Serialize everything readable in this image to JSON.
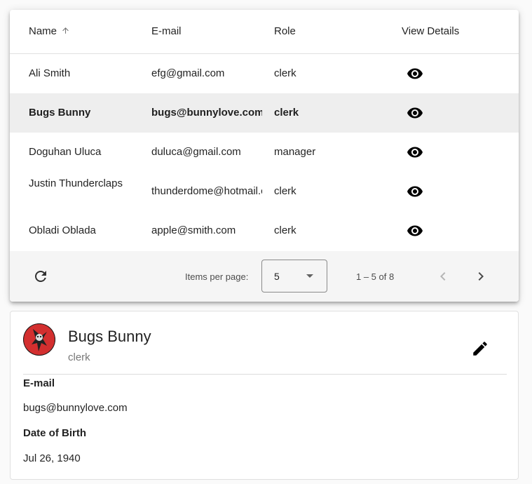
{
  "table": {
    "headers": {
      "name": "Name",
      "email": "E-mail",
      "role": "Role",
      "view": "View Details"
    },
    "sort": {
      "column": "name",
      "direction": "ascending",
      "icon": "arrow-up-icon"
    },
    "rows": [
      {
        "name": "Ali Smith",
        "email": "efg@gmail.com",
        "role": "clerk",
        "selected": false
      },
      {
        "name": "Bugs Bunny",
        "email": "bugs@bunnylove.com",
        "role": "clerk",
        "selected": true
      },
      {
        "name": "Doguhan Uluca",
        "email": "duluca@gmail.com",
        "role": "manager",
        "selected": false
      },
      {
        "name": "Justin Thunderclaps",
        "email": "thunderdome@hotmail.com",
        "role": "clerk",
        "selected": false
      },
      {
        "name": "Obladi Oblada",
        "email": "apple@smith.com",
        "role": "clerk",
        "selected": false
      }
    ]
  },
  "paginator": {
    "items_per_page_label": "Items per page:",
    "page_size": "5",
    "range_label": "1 – 5 of 8",
    "icons": {
      "refresh": "refresh-icon",
      "prev": "chevron-left-icon",
      "next": "chevron-right-icon"
    }
  },
  "detail": {
    "name": "Bugs Bunny",
    "role": "clerk",
    "email_label": "E-mail",
    "email": "bugs@bunnylove.com",
    "dob_label": "Date of Birth",
    "dob": "Jul 26, 1940",
    "icons": {
      "edit": "pencil-icon",
      "avatar": "avatar"
    }
  },
  "colors": {
    "selected_row": "#eeeeee",
    "paginator_bg": "#f5f5f5",
    "avatar_bg": "#d32f2f"
  }
}
